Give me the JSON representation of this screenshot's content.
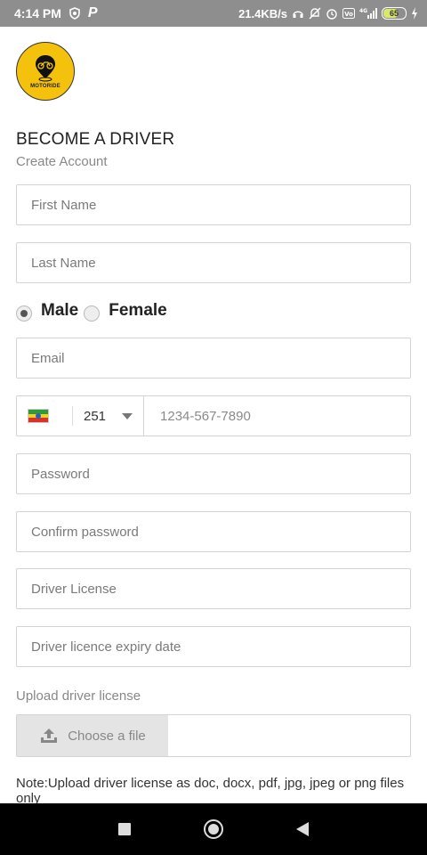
{
  "status_bar": {
    "time": "4:14 PM",
    "network_speed": "21.4KB/s",
    "network_type": "4G",
    "battery_level": "65",
    "icons": [
      "shield-icon",
      "p-icon",
      "headset-icon",
      "mute-icon",
      "alarm-icon",
      "volte-icon",
      "signal-icon",
      "battery-icon",
      "charging-icon"
    ]
  },
  "brand": {
    "logo_text": "MOTORIDE",
    "accent_color": "#f4c20d"
  },
  "header": {
    "title": "BECOME A DRIVER",
    "subtitle": "Create Account"
  },
  "form": {
    "first_name_placeholder": "First Name",
    "last_name_placeholder": "Last Name",
    "gender_options": [
      {
        "label": "Male",
        "selected": true
      },
      {
        "label": "Female",
        "selected": false
      }
    ],
    "email_placeholder": "Email",
    "phone": {
      "country_code": "251",
      "flag_icon": "ethiopia-flag-icon",
      "placeholder": "1234-567-7890"
    },
    "password_placeholder": "Password",
    "confirm_password_placeholder": "Confirm password",
    "driver_license_placeholder": "Driver License",
    "license_expiry_placeholder": "Driver licence expiry date",
    "upload_label": "Upload driver license",
    "choose_file_label": "Choose a file",
    "note": "Note:Upload driver license as doc, docx, pdf, jpg, jpeg or png files only"
  },
  "nav_bar": {
    "icons": [
      "recents-square-icon",
      "home-circle-icon",
      "back-triangle-icon"
    ]
  }
}
